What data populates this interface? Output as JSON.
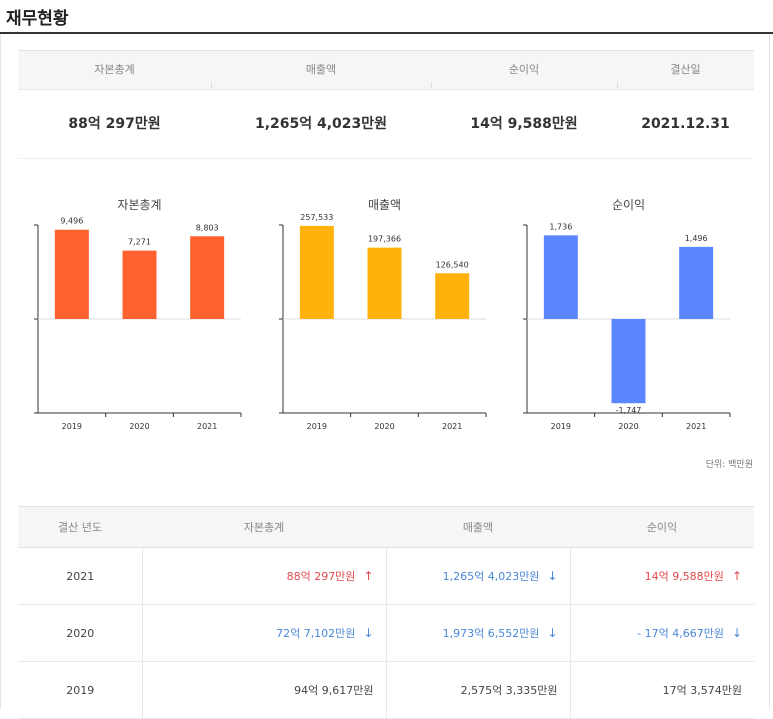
{
  "page_title": "재무현황",
  "summary": {
    "headers": [
      "자본총계",
      "매출액",
      "순이익",
      "결산일"
    ],
    "values": [
      "88억 297만원",
      "1,265억 4,023만원",
      "14억 9,588만원",
      "2021.12.31"
    ]
  },
  "unit_note": "단위: 백만원",
  "colors": {
    "capital": "#ff622e",
    "revenue": "#ffb20b",
    "profit": "#5c86ff",
    "up": "#e0494d",
    "down": "#4a86d6"
  },
  "chart_data": [
    {
      "type": "bar",
      "title": "자본총계",
      "categories": [
        "2019",
        "2020",
        "2021"
      ],
      "values": [
        9496,
        7271,
        8803
      ],
      "labels": [
        "9,496",
        "7,271",
        "8,803"
      ],
      "ylim": [
        -10000,
        10000
      ],
      "grid": false
    },
    {
      "type": "bar",
      "title": "매출액",
      "categories": [
        "2019",
        "2020",
        "2021"
      ],
      "values": [
        257533,
        197366,
        126540
      ],
      "labels": [
        "257,533",
        "197,366",
        "126,540"
      ],
      "ylim": [
        -260000,
        260000
      ],
      "grid": false
    },
    {
      "type": "bar",
      "title": "순이익",
      "categories": [
        "2019",
        "2020",
        "2021"
      ],
      "values": [
        1736,
        -1747,
        1496
      ],
      "labels": [
        "1,736",
        "-1,747",
        "1,496"
      ],
      "ylim": [
        -1950,
        1950
      ],
      "grid": false
    }
  ],
  "table": {
    "headers": [
      "결산 년도",
      "자본총계",
      "매출액",
      "순이익"
    ],
    "rows": [
      {
        "year": "2021",
        "capital": {
          "text": "88억 297만원",
          "trend": "up",
          "arrow": "↑"
        },
        "revenue": {
          "text": "1,265억 4,023만원",
          "trend": "down",
          "arrow": "↓"
        },
        "profit": {
          "text": "14억 9,588만원",
          "trend": "up",
          "arrow": "↑"
        }
      },
      {
        "year": "2020",
        "capital": {
          "text": "72억 7,102만원",
          "trend": "down",
          "arrow": "↓"
        },
        "revenue": {
          "text": "1,973억 6,552만원",
          "trend": "down",
          "arrow": "↓"
        },
        "profit": {
          "text": "- 17억 4,667만원",
          "trend": "down",
          "arrow": "↓"
        }
      },
      {
        "year": "2019",
        "capital": {
          "text": "94억 9,617만원",
          "trend": "none",
          "arrow": ""
        },
        "revenue": {
          "text": "2,575억 3,335만원",
          "trend": "none",
          "arrow": ""
        },
        "profit": {
          "text": "17억 3,574만원",
          "trend": "none",
          "arrow": ""
        }
      }
    ]
  }
}
